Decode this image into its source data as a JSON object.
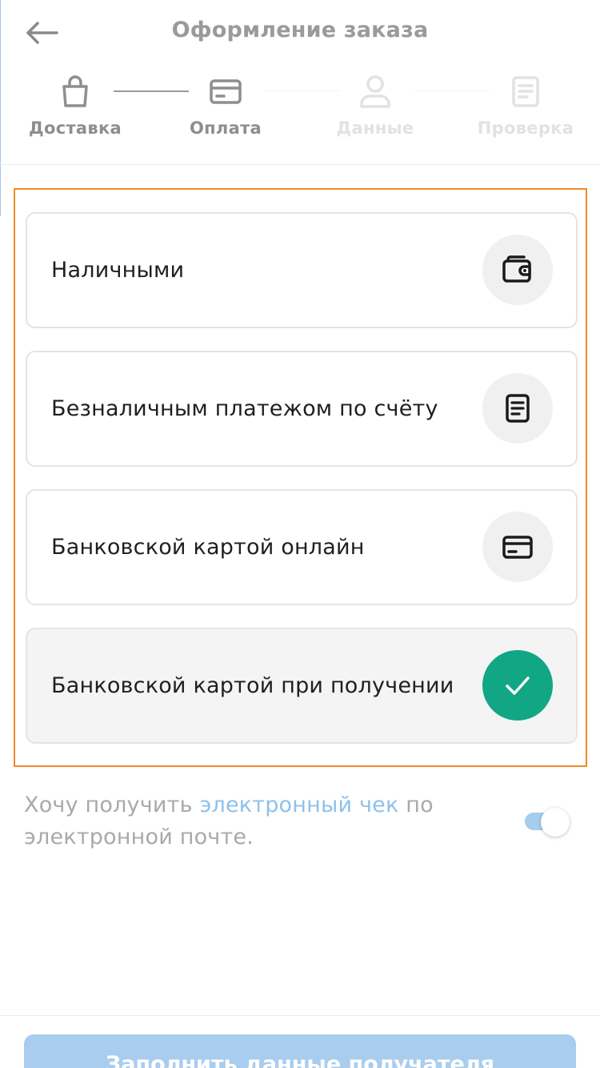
{
  "header": {
    "title": "Оформление заказа"
  },
  "steps": [
    {
      "label": "Доставка",
      "state": "done",
      "icon": "bag-icon"
    },
    {
      "label": "Оплата",
      "state": "done",
      "icon": "card-icon"
    },
    {
      "label": "Данные",
      "state": "todo",
      "icon": "user-icon"
    },
    {
      "label": "Проверка",
      "state": "todo",
      "icon": "document-icon"
    }
  ],
  "payment_options": [
    {
      "label": "Наличными",
      "icon": "wallet-icon",
      "selected": false
    },
    {
      "label": "Безналичным платежом по счёту",
      "icon": "invoice-icon",
      "selected": false
    },
    {
      "label": "Банковской картой онлайн",
      "icon": "card-icon",
      "selected": false
    },
    {
      "label": "Банковской картой при получении",
      "icon": "checkmark-icon",
      "selected": true
    }
  ],
  "receipt": {
    "text_before": "Хочу получить ",
    "link_text": "электронный чек",
    "text_after": " по электронной почте.",
    "toggle_on": true
  },
  "cta": {
    "label": "Заполнить данные получателя"
  },
  "colors": {
    "accent": "#12a784",
    "highlight_frame": "#f08a24",
    "link": "#8fc1ea",
    "cta": "#a9cdee"
  }
}
